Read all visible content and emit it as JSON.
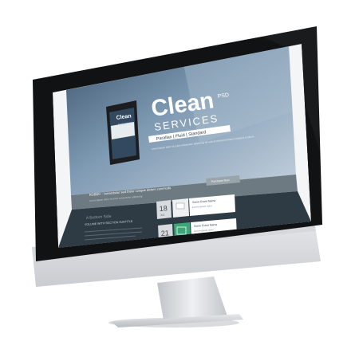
{
  "device": {
    "kind": "imac-monitor"
  },
  "website": {
    "brand_word": "Clean",
    "brand_suffix": "PSD",
    "brand_sub": "SERVICES",
    "tagline": "Parallax | Fluid | Standard",
    "hero_paragraph": "Lorem ipsum dolor sit amet consectetur adipiscing elit sed do eiusmod tempor incididunt ut labore",
    "phone": {
      "app_name": "Clean",
      "app_sub": "SERVICES"
    },
    "cta_bar": {
      "text": "ROBBO - consectetur sed Dolor congue dictum commodo",
      "subtext": "Lorem ipsum dolor sit amet consectetur adipiscing",
      "button_label": "Purchase Now"
    },
    "section": {
      "pre_title": "A Bottom Side",
      "title": "VOLUME WITH SECTION SUBTITLE"
    },
    "events": [
      {
        "day": "18",
        "month": "JUL",
        "title": "Some Event Name",
        "detail": "Lorem ipsum dolor"
      },
      {
        "day": "21",
        "month": "JUL",
        "title": "Some Event Name",
        "detail": "Lorem ipsum dolor"
      }
    ]
  },
  "colors": {
    "bezel": "#111214",
    "aluminum": "#cfd2d6",
    "site_dark": "#2e3a44",
    "hero_blue": "#5d7c98",
    "cta_bar": "#6e7a82",
    "accent_green": "#3aa776",
    "button": "#9aa4ab"
  }
}
